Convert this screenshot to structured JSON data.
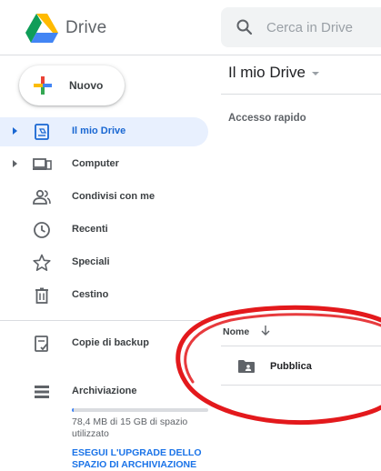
{
  "header": {
    "app_title": "Drive",
    "search_placeholder": "Cerca in Drive"
  },
  "new_button": {
    "label": "Nuovo"
  },
  "sidebar": {
    "items": [
      {
        "label": "Il mio Drive",
        "icon": "my-drive-icon",
        "active": true
      },
      {
        "label": "Computer",
        "icon": "computer-icon"
      },
      {
        "label": "Condivisi con me",
        "icon": "shared-with-me-icon"
      },
      {
        "label": "Recenti",
        "icon": "clock-icon"
      },
      {
        "label": "Speciali",
        "icon": "star-icon"
      },
      {
        "label": "Cestino",
        "icon": "trash-icon"
      },
      {
        "label": "Copie di backup",
        "icon": "backup-icon"
      },
      {
        "label": "Archiviazione",
        "icon": "storage-icon"
      }
    ],
    "storage": {
      "used_fraction": 0.005,
      "text": "78,4 MB di 15 GB di spazio utilizzato",
      "upgrade_link": "ESEGUI L'UPGRADE DELLO SPAZIO DI ARCHIVIAZIONE"
    }
  },
  "main": {
    "title": "Il mio Drive",
    "quick_access": "Accesso rapido",
    "column_header": "Nome",
    "files": [
      {
        "name": "Pubblica",
        "icon": "shared-folder-icon"
      }
    ]
  },
  "colors": {
    "accent_blue": "#1967d2",
    "active_bg": "#e8f0fe",
    "annotation_red": "#e3191c"
  }
}
